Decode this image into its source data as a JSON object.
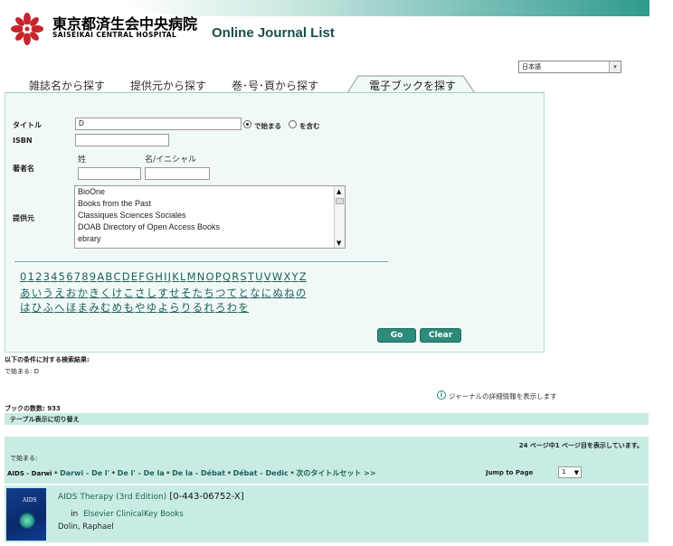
{
  "header": {
    "hospital_name": "東京都済生会中央病院",
    "hospital_name_en": "SAISEIKAI CENTRAL HOSPITAL",
    "site_title": "Online Journal List"
  },
  "language": {
    "selected": "日本語"
  },
  "tabs": [
    {
      "label": "雑誌名から探す"
    },
    {
      "label": "提供元から探す"
    },
    {
      "label": "巻･号･頁から探す"
    },
    {
      "label": "電子ブックを探す",
      "active": true
    }
  ],
  "form": {
    "title_label": "タイトル",
    "title_value": "D",
    "starts_with_label": "で始まる",
    "contains_label": "を含む",
    "isbn_label": "ISBN",
    "author_label": "著者名",
    "surname_label": "姓",
    "givenname_label": "名/イニシャル",
    "provider_label": "提供元",
    "providers": [
      "BioOne",
      "Books from the Past",
      "Classiques Sciences Sociales",
      "DOAB Directory of Open Access Books",
      "ebrary"
    ],
    "alpha_row1": [
      "0",
      "1",
      "2",
      "3",
      "4",
      "5",
      "6",
      "7",
      "8",
      "9",
      "A",
      "B",
      "C",
      "D",
      "E",
      "F",
      "G",
      "H",
      "I",
      "J",
      "K",
      "L",
      "M",
      "N",
      "O",
      "P",
      "Q",
      "R",
      "S",
      "T",
      "U",
      "V",
      "W",
      "X",
      "Y",
      "Z"
    ],
    "alpha_row2": [
      "あ",
      "い",
      "う",
      "え",
      "お",
      "か",
      "き",
      "く",
      "け",
      "こ",
      "さ",
      "し",
      "す",
      "せ",
      "そ",
      "た",
      "ち",
      "つ",
      "て",
      "と",
      "な",
      "に",
      "ぬ",
      "ね",
      "の"
    ],
    "alpha_row3": [
      "は",
      "ひ",
      "ふ",
      "へ",
      "ほ",
      "ま",
      "み",
      "む",
      "め",
      "も",
      "や",
      "ゆ",
      "よ",
      "ら",
      "り",
      "る",
      "れ",
      "ろ",
      "わ",
      "を"
    ],
    "go_label": "Go",
    "clear_label": "Clear"
  },
  "results": {
    "criteria_heading": "以下の条件に対する検索結果:",
    "criteria_value": "で始まる: D",
    "info_label": "ジャーナルの詳細情報を表示します",
    "count_text": "ブックの数数: 933",
    "table_toggle": "テーブル表示に切り替え",
    "page_info": "24 ページ中1 ページ目を表示しています。",
    "starts_label": "で始まる:",
    "range_prefix": "AIDS - Darwi",
    "range_links": [
      "Darwi - De l'",
      "De l' - De la",
      "De la - Débat",
      "Débat - Dedic"
    ],
    "next_set": "次のタイトルセット >>",
    "jump_label": "Jump to Page",
    "jump_value": "1"
  },
  "book": {
    "title": "AIDS Therapy (3rd Edition)",
    "isbn": "[0-443-06752-X]",
    "in_label": "in",
    "provider": "Elsevier ClinicalKey Books",
    "author": "Dolin, Raphael",
    "cover_text": "AIDS"
  },
  "colors": {
    "accent": "#2e8a7a",
    "panel_bg": "#f1f9f7",
    "bar_bg": "#c8ece4",
    "title_color": "#174f4a"
  }
}
